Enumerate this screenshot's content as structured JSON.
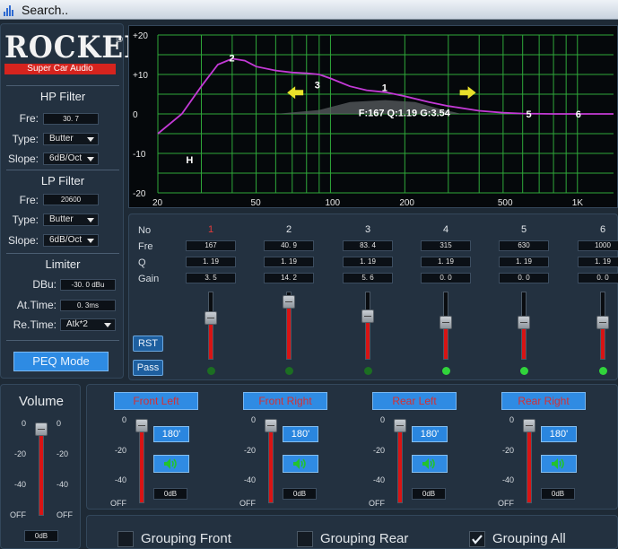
{
  "window": {
    "title": "Search.."
  },
  "brand": {
    "name": "ROCKERA",
    "reg": "®",
    "tagline": "Super Car Audio"
  },
  "hp_filter": {
    "heading": "HP Filter",
    "fre_label": "Fre:",
    "fre_value": "30. 7",
    "type_label": "Type:",
    "type_value": "Butter",
    "slope_label": "Slope:",
    "slope_value": "6dB/Oct"
  },
  "lp_filter": {
    "heading": "LP Filter",
    "fre_label": "Fre:",
    "fre_value": "20600",
    "type_label": "Type:",
    "type_value": "Butter",
    "slope_label": "Slope:",
    "slope_value": "6dB/Oct"
  },
  "limiter": {
    "heading": "Limiter",
    "dbu_label": "DBu:",
    "dbu_value": "-30. 0 dBu",
    "at_label": "At.Time:",
    "at_value": "0. 3ms",
    "re_label": "Re.Time:",
    "re_value": "Atk*2"
  },
  "peq_mode": "PEQ Mode",
  "graph": {
    "y_ticks": [
      "+20",
      "+10",
      "0",
      "-10",
      "-20"
    ],
    "x_ticks": [
      "20",
      "50",
      "100",
      "200",
      "500",
      "1K"
    ],
    "band_labels": [
      "1",
      "2",
      "3",
      "5",
      "6",
      "H"
    ],
    "info": "F:167 Q:1.19 G:3.54"
  },
  "chart_data": {
    "type": "line",
    "xlabel": "",
    "ylabel": "",
    "xlim": [
      20,
      1400
    ],
    "ylim": [
      -20,
      20
    ],
    "x_scale": "log",
    "grid": true,
    "series": [
      {
        "values": [
          [
            20,
            -5
          ],
          [
            25,
            0
          ],
          [
            30,
            7
          ],
          [
            35,
            12.5
          ],
          [
            40,
            14
          ],
          [
            45,
            13.5
          ],
          [
            50,
            12
          ],
          [
            60,
            11
          ],
          [
            70,
            10.5
          ],
          [
            80,
            10.3
          ],
          [
            90,
            10
          ],
          [
            100,
            9
          ],
          [
            120,
            7
          ],
          [
            140,
            6
          ],
          [
            167,
            5.5
          ],
          [
            200,
            4.5
          ],
          [
            250,
            3
          ],
          [
            300,
            2
          ],
          [
            400,
            0.8
          ],
          [
            500,
            0.3
          ],
          [
            600,
            0.1
          ],
          [
            800,
            0
          ],
          [
            1000,
            0
          ],
          [
            1400,
            0
          ]
        ]
      }
    ],
    "markers": [
      {
        "label": "1",
        "x": 167,
        "y": 3.5
      },
      {
        "label": "2",
        "x": 40.9,
        "y": 14.2
      },
      {
        "label": "3",
        "x": 83.4,
        "y": 5.6
      },
      {
        "label": "5",
        "x": 630,
        "y": 0
      },
      {
        "label": "6",
        "x": 1000,
        "y": 0
      }
    ]
  },
  "eq": {
    "headers": {
      "no": "No",
      "fre": "Fre",
      "q": "Q",
      "gain": "Gain"
    },
    "bands": [
      {
        "no": "1",
        "fre": "167",
        "q": "1. 19",
        "gain": "3. 5",
        "level": 0.62
      },
      {
        "no": "2",
        "fre": "40. 9",
        "q": "1. 19",
        "gain": "14. 2",
        "level": 0.85
      },
      {
        "no": "3",
        "fre": "83. 4",
        "q": "1. 19",
        "gain": "5. 6",
        "level": 0.65
      },
      {
        "no": "4",
        "fre": "315",
        "q": "1. 19",
        "gain": "0. 0",
        "level": 0.55
      },
      {
        "no": "5",
        "fre": "630",
        "q": "1. 19",
        "gain": "0. 0",
        "level": 0.55
      },
      {
        "no": "6",
        "fre": "1000",
        "q": "1. 19",
        "gain": "0. 0",
        "level": 0.55
      }
    ],
    "rst": "RST",
    "pass": "Pass",
    "colors": {
      "active_no": "#e53b3b",
      "led_on": "#31d43b",
      "led_dim": "#1c6e22"
    }
  },
  "volume": {
    "heading": "Volume",
    "scale": [
      "0",
      "-20",
      "-40",
      "OFF"
    ],
    "value": "0dB",
    "level": 0.93
  },
  "outputs": [
    {
      "label": "Front Left",
      "phase": "180'",
      "db": "0dB",
      "level": 0.93
    },
    {
      "label": "Front Right",
      "phase": "180'",
      "db": "0dB",
      "level": 0.93
    },
    {
      "label": "Rear Left",
      "phase": "180'",
      "db": "0dB",
      "level": 0.93
    },
    {
      "label": "Rear Right",
      "phase": "180'",
      "db": "0dB",
      "level": 0.93
    }
  ],
  "output_scale": [
    "0",
    "-20",
    "-40",
    "OFF"
  ],
  "grouping": [
    {
      "label": "Grouping Front",
      "checked": false
    },
    {
      "label": "Grouping Rear",
      "checked": false
    },
    {
      "label": "Grouping All",
      "checked": true
    }
  ]
}
